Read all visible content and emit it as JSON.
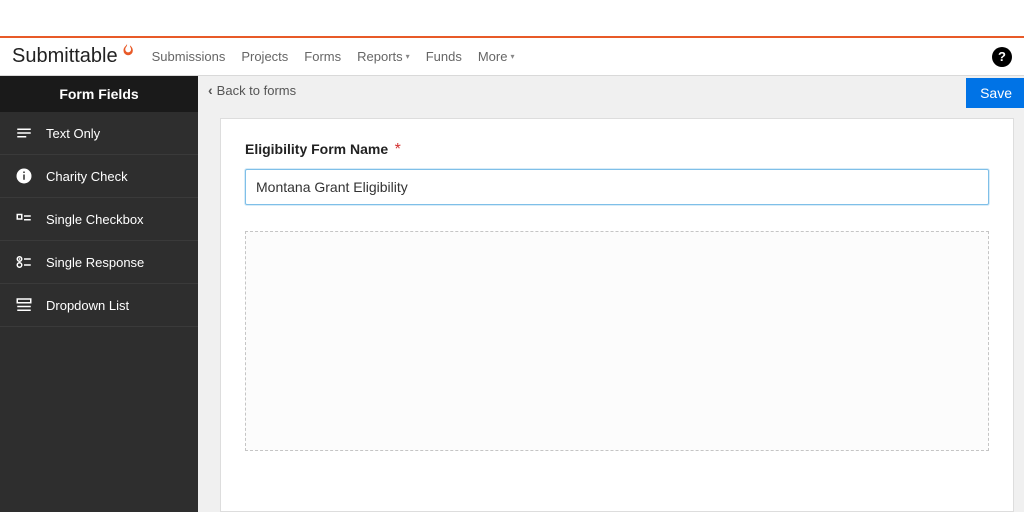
{
  "brand": {
    "name": "Submittable"
  },
  "nav": {
    "items": [
      {
        "label": "Submissions",
        "dropdown": false
      },
      {
        "label": "Projects",
        "dropdown": false
      },
      {
        "label": "Forms",
        "dropdown": false
      },
      {
        "label": "Reports",
        "dropdown": true
      },
      {
        "label": "Funds",
        "dropdown": false
      },
      {
        "label": "More",
        "dropdown": true
      }
    ]
  },
  "sidebar": {
    "header": "Form Fields",
    "items": [
      {
        "label": "Text Only"
      },
      {
        "label": "Charity Check"
      },
      {
        "label": "Single Checkbox"
      },
      {
        "label": "Single Response"
      },
      {
        "label": "Dropdown List"
      }
    ]
  },
  "toolbar": {
    "back_label": "Back to forms",
    "save_label": "Save"
  },
  "form": {
    "name_label": "Eligibility Form Name",
    "name_value": "Montana Grant Eligibility",
    "required_mark": "*"
  }
}
